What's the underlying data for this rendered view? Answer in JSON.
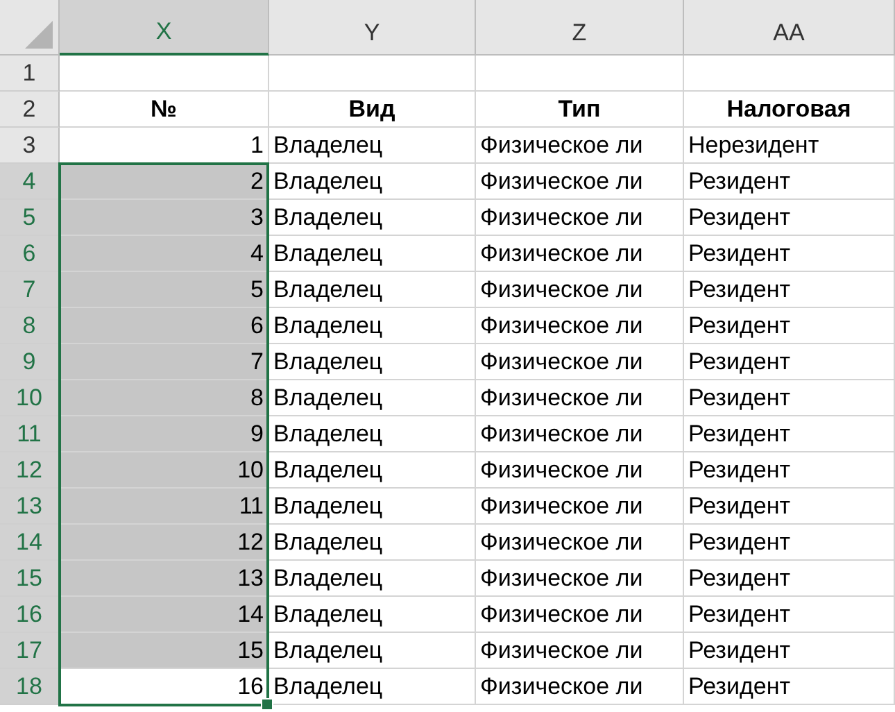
{
  "columns": [
    {
      "label": "X",
      "selected": true
    },
    {
      "label": "Y",
      "selected": false
    },
    {
      "label": "Z",
      "selected": false
    },
    {
      "label": "AA",
      "selected": false
    }
  ],
  "rows": [
    {
      "number": "1",
      "cells": [
        "",
        "",
        "",
        ""
      ],
      "selected": false
    },
    {
      "number": "2",
      "cells": [
        "№",
        "Вид",
        "Тип",
        "Налоговая"
      ],
      "kind": "heading",
      "selected": false
    },
    {
      "number": "3",
      "cells": [
        "1",
        "Владелец",
        "Физическое ли",
        "Нерезидент"
      ],
      "selected": false
    },
    {
      "number": "4",
      "cells": [
        "2",
        "Владелец",
        "Физическое ли",
        "Резидент"
      ],
      "selected": true,
      "active": false
    },
    {
      "number": "5",
      "cells": [
        "3",
        "Владелец",
        "Физическое ли",
        "Резидент"
      ],
      "selected": true,
      "active": false
    },
    {
      "number": "6",
      "cells": [
        "4",
        "Владелец",
        "Физическое ли",
        "Резидент"
      ],
      "selected": true,
      "active": false
    },
    {
      "number": "7",
      "cells": [
        "5",
        "Владелец",
        "Физическое ли",
        "Резидент"
      ],
      "selected": true,
      "active": false
    },
    {
      "number": "8",
      "cells": [
        "6",
        "Владелец",
        "Физическое ли",
        "Резидент"
      ],
      "selected": true,
      "active": false
    },
    {
      "number": "9",
      "cells": [
        "7",
        "Владелец",
        "Физическое ли",
        "Резидент"
      ],
      "selected": true,
      "active": false
    },
    {
      "number": "10",
      "cells": [
        "8",
        "Владелец",
        "Физическое ли",
        "Резидент"
      ],
      "selected": true,
      "active": false
    },
    {
      "number": "11",
      "cells": [
        "9",
        "Владелец",
        "Физическое ли",
        "Резидент"
      ],
      "selected": true,
      "active": false
    },
    {
      "number": "12",
      "cells": [
        "10",
        "Владелец",
        "Физическое ли",
        "Резидент"
      ],
      "selected": true,
      "active": false
    },
    {
      "number": "13",
      "cells": [
        "11",
        "Владелец",
        "Физическое ли",
        "Резидент"
      ],
      "selected": true,
      "active": false
    },
    {
      "number": "14",
      "cells": [
        "12",
        "Владелец",
        "Физическое ли",
        "Резидент"
      ],
      "selected": true,
      "active": false
    },
    {
      "number": "15",
      "cells": [
        "13",
        "Владелец",
        "Физическое ли",
        "Резидент"
      ],
      "selected": true,
      "active": false
    },
    {
      "number": "16",
      "cells": [
        "14",
        "Владелец",
        "Физическое ли",
        "Резидент"
      ],
      "selected": true,
      "active": false
    },
    {
      "number": "17",
      "cells": [
        "15",
        "Владелец",
        "Физическое ли",
        "Резидент"
      ],
      "selected": true,
      "active": false
    },
    {
      "number": "18",
      "cells": [
        "16",
        "Владелец",
        "Физическое ли",
        "Резидент"
      ],
      "selected": true,
      "active": true
    }
  ]
}
